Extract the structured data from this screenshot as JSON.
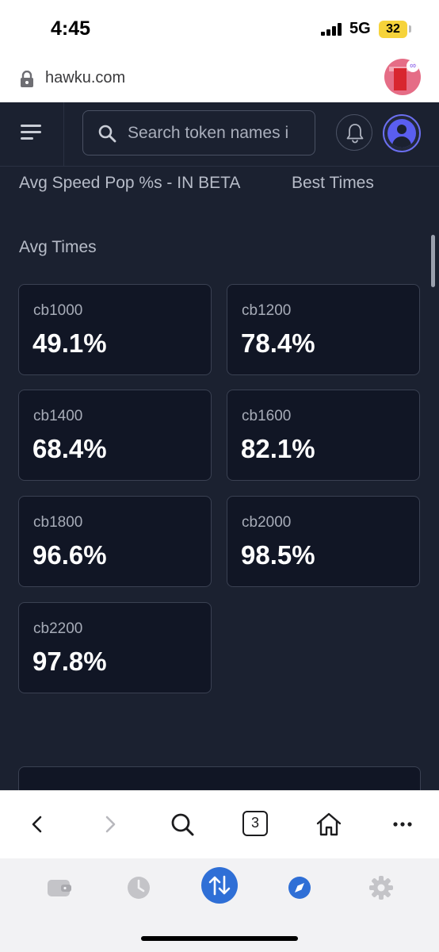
{
  "status_bar": {
    "time": "4:45",
    "network": "5G",
    "battery": "32"
  },
  "browser": {
    "url": "hawku.com"
  },
  "header": {
    "search_placeholder": "Search token names i"
  },
  "tabs": [
    {
      "label": "Avg Speed Pop %s - IN BETA"
    },
    {
      "label": "Best Times"
    }
  ],
  "section": {
    "title": "Avg Times"
  },
  "cards": [
    {
      "label": "cb1000",
      "value": "49.1%"
    },
    {
      "label": "cb1200",
      "value": "78.4%"
    },
    {
      "label": "cb1400",
      "value": "68.4%"
    },
    {
      "label": "cb1600",
      "value": "82.1%"
    },
    {
      "label": "cb1800",
      "value": "96.6%"
    },
    {
      "label": "cb2000",
      "value": "98.5%"
    },
    {
      "label": "cb2200",
      "value": "97.8%"
    }
  ],
  "toolbar": {
    "tab_count": "3"
  },
  "colors": {
    "app_background": "#1b2130",
    "card_background": "#111625",
    "accent": "#2f6fd6",
    "profile": "#5a5ef0"
  }
}
